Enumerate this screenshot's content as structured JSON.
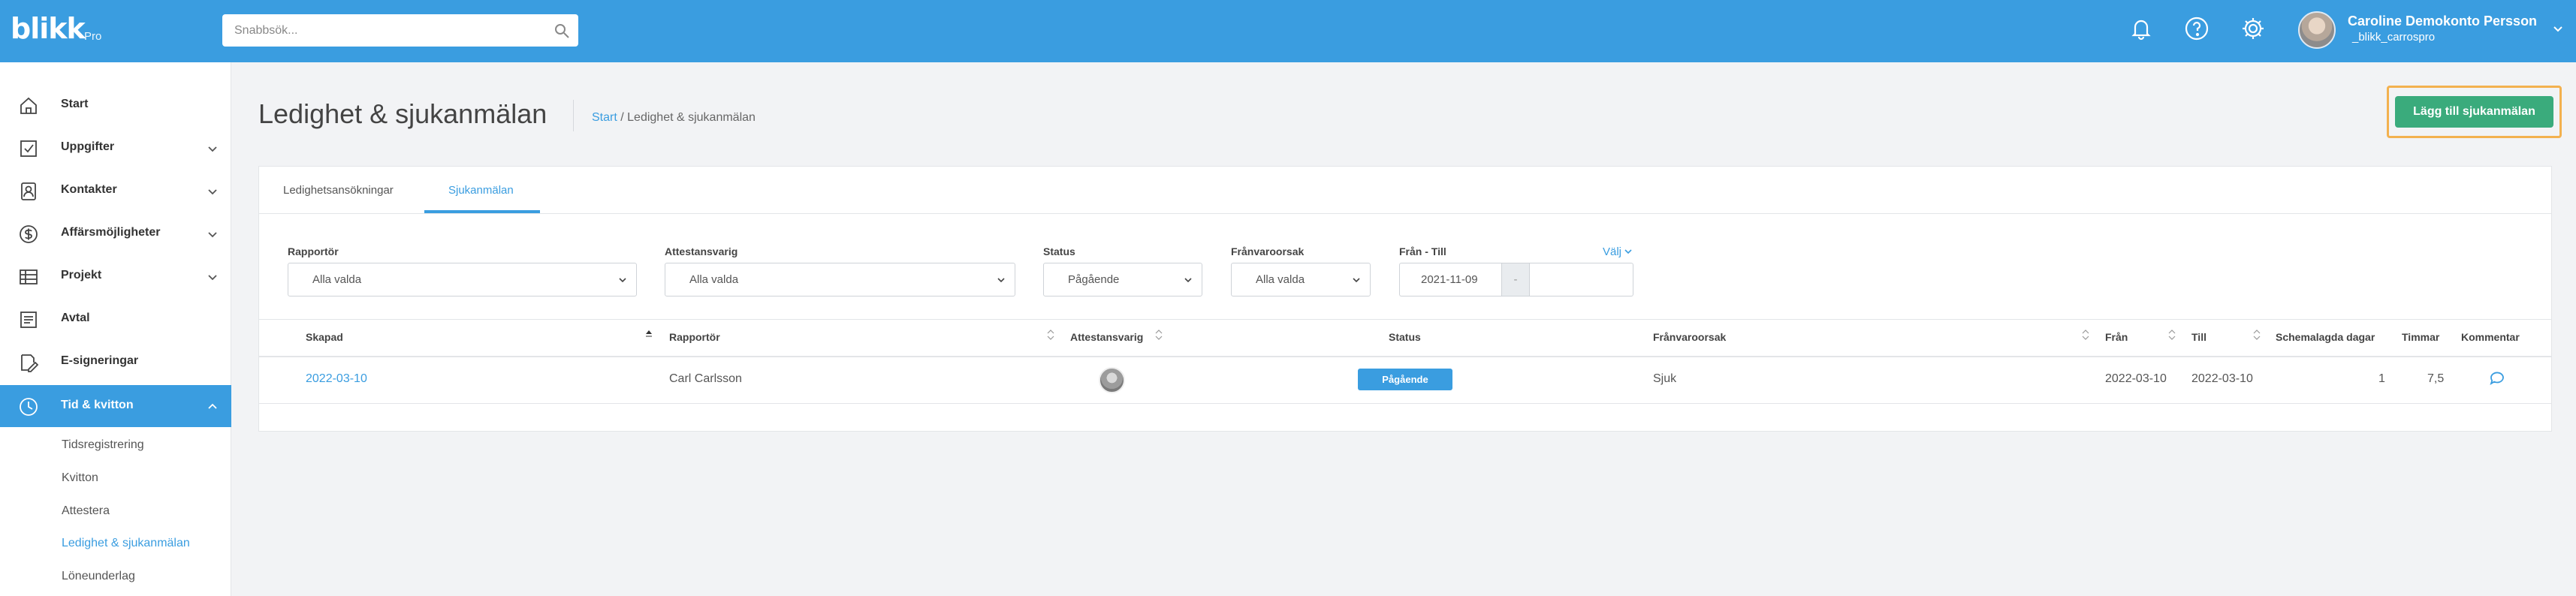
{
  "app": {
    "logo": "blikk",
    "logo_sub": "Pro"
  },
  "search": {
    "placeholder": "Snabbsök..."
  },
  "user": {
    "name": "Caroline Demokonto Persson",
    "username": "_blikk_carrospro"
  },
  "sidebar": {
    "items": [
      {
        "label": "Start",
        "icon": "home-icon"
      },
      {
        "label": "Uppgifter",
        "icon": "checkbox-icon"
      },
      {
        "label": "Kontakter",
        "icon": "contact-icon"
      },
      {
        "label": "Affärsmöjligheter",
        "icon": "dollar-icon"
      },
      {
        "label": "Projekt",
        "icon": "table-icon"
      },
      {
        "label": "Avtal",
        "icon": "document-icon"
      },
      {
        "label": "E-signeringar",
        "icon": "signature-icon"
      },
      {
        "label": "Tid & kvitton",
        "icon": "clock-icon"
      }
    ],
    "subitems": [
      {
        "label": "Tidsregistrering"
      },
      {
        "label": "Kvitton"
      },
      {
        "label": "Attestera"
      },
      {
        "label": "Ledighet & sjukanmälan"
      },
      {
        "label": "Löneunderlag"
      }
    ]
  },
  "page": {
    "title": "Ledighet & sjukanmälan",
    "breadcrumb_link": "Start",
    "breadcrumb_sep": " / ",
    "breadcrumb_current": "Ledighet & sjukanmälan",
    "add_button": "Lägg till sjukanmälan"
  },
  "tabs": [
    {
      "label": "Ledighetsansökningar"
    },
    {
      "label": "Sjukanmälan"
    }
  ],
  "filters": {
    "reporter": {
      "label": "Rapportör",
      "value": "Alla valda"
    },
    "approver": {
      "label": "Attestansvarig",
      "value": "Alla valda"
    },
    "status": {
      "label": "Status",
      "value": "Pågående"
    },
    "reason": {
      "label": "Frånvaroorsak",
      "value": "Alla valda"
    },
    "date": {
      "label": "Från - Till",
      "from": "2021-11-09",
      "sep": "-",
      "choose": "Välj"
    }
  },
  "table": {
    "headers": [
      "Skapad",
      "Rapportör",
      "Attestansvarig",
      "Status",
      "Frånvaroorsak",
      "Från",
      "Till",
      "Schemalagda dagar",
      "Timmar",
      "Kommentar"
    ],
    "rows": [
      {
        "created": "2022-03-10",
        "reporter": "Carl Carlsson",
        "status": "Pågående",
        "reason": "Sjuk",
        "from": "2022-03-10",
        "to": "2022-03-10",
        "days": "1",
        "hours": "7,5"
      }
    ]
  },
  "colors": {
    "primary": "#3a9de0",
    "success": "#3aab7c",
    "highlight": "#f3b14f"
  }
}
